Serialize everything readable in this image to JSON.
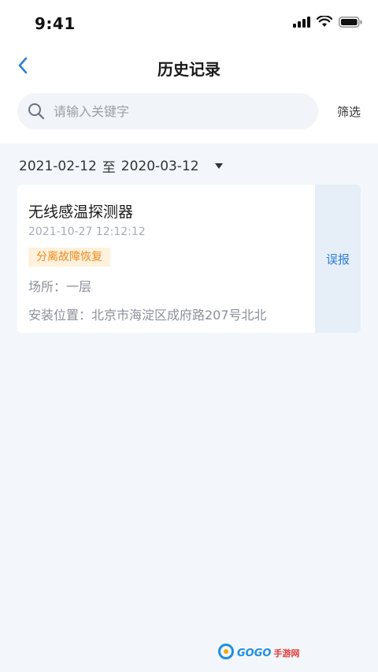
{
  "status_bar": {
    "time": "9:41",
    "icons": [
      "signal-icon",
      "wifi-icon",
      "battery-icon"
    ]
  },
  "nav": {
    "title": "历史记录",
    "back_icon": "chevron-left-icon"
  },
  "search": {
    "placeholder": "请输入关键字",
    "value": "",
    "filter_label": "筛选"
  },
  "date_range": {
    "start": "2021-02-12",
    "separator": "至",
    "end": "2020-03-12"
  },
  "records": [
    {
      "title": "无线感温探测器",
      "time": "2021-10-27 12:12:12",
      "badge": "分离故障恢复",
      "location": "场所：一层",
      "address": "安装位置：北京市海淀区成府路207号北北",
      "action_label": "误报"
    }
  ],
  "watermark": {
    "brand": "GOGO",
    "suffix": "手游网"
  },
  "colors": {
    "accent": "#2f7fd6",
    "badge_bg": "#fff1dc",
    "badge_text": "#f08a1c",
    "content_bg": "#f3f7fb"
  }
}
